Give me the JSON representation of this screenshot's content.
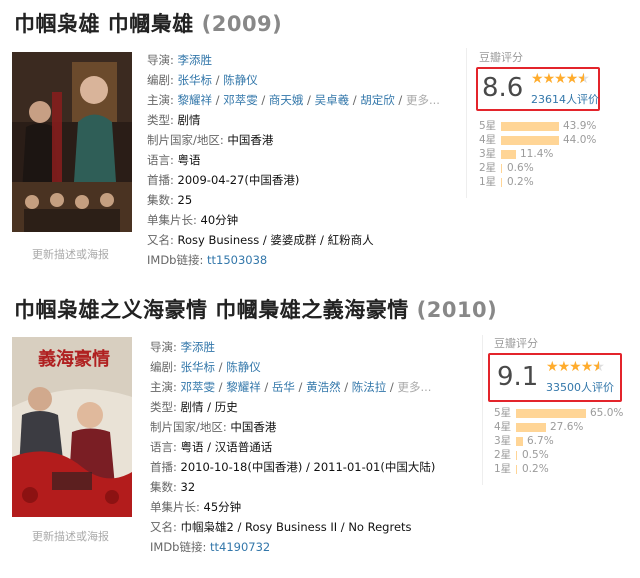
{
  "movies": [
    {
      "title": "巾帼枭雄 巾幗梟雄",
      "year": "(2009)",
      "poster_link": "更新描述或海报",
      "rows": {
        "director_label": "导演:",
        "director": "李添胜",
        "writer_label": "编剧:",
        "writers": [
          "张华标",
          "陈静仪"
        ],
        "cast_label": "主演:",
        "cast": [
          "黎耀祥",
          "邓萃雯",
          "商天娥",
          "吴卓羲",
          "胡定欣"
        ],
        "more": "更多...",
        "genre_label": "类型:",
        "genre": "剧情",
        "country_label": "制片国家/地区:",
        "country": "中国香港",
        "language_label": "语言:",
        "language": "粤语",
        "premiere_label": "首播:",
        "premiere": "2009-04-27(中国香港)",
        "episodes_label": "集数:",
        "episodes": "25",
        "runtime_label": "单集片长:",
        "runtime": "40分钟",
        "aka_label": "又名:",
        "aka": "Rosy Business / 婆婆成群 / 紅粉商人",
        "imdb_label": "IMDb链接:",
        "imdb": "tt1503038"
      },
      "rating": {
        "heading": "豆瓣评分",
        "score": "8.6",
        "votes": "23614人评价",
        "stars_value": 4.5,
        "distribution": [
          {
            "label": "5星",
            "pct": "43.9%",
            "value": 43.9
          },
          {
            "label": "4星",
            "pct": "44.0%",
            "value": 44.0
          },
          {
            "label": "3星",
            "pct": "11.4%",
            "value": 11.4
          },
          {
            "label": "2星",
            "pct": "0.6%",
            "value": 0.6
          },
          {
            "label": "1星",
            "pct": "0.2%",
            "value": 0.2
          }
        ]
      }
    },
    {
      "title": "巾帼枭雄之义海豪情 巾幗梟雄之義海豪情",
      "year": "(2010)",
      "poster_link": "更新描述或海报",
      "rows": {
        "director_label": "导演:",
        "director": "李添胜",
        "writer_label": "编剧:",
        "writers": [
          "张华标",
          "陈静仪"
        ],
        "cast_label": "主演:",
        "cast": [
          "邓萃雯",
          "黎耀祥",
          "岳华",
          "黄浩然",
          "陈法拉"
        ],
        "more": "更多...",
        "genre_label": "类型:",
        "genre": "剧情 / 历史",
        "country_label": "制片国家/地区:",
        "country": "中国香港",
        "language_label": "语言:",
        "language": "粤语 / 汉语普通话",
        "premiere_label": "首播:",
        "premiere": "2010-10-18(中国香港) / 2011-01-01(中国大陆)",
        "episodes_label": "集数:",
        "episodes": "32",
        "runtime_label": "单集片长:",
        "runtime": "45分钟",
        "aka_label": "又名:",
        "aka": "巾帼枭雄2 / Rosy Business II / No Regrets",
        "imdb_label": "IMDb链接:",
        "imdb": "tt4190732"
      },
      "rating": {
        "heading": "豆瓣评分",
        "score": "9.1",
        "votes": "33500人评价",
        "stars_value": 4.5,
        "distribution": [
          {
            "label": "5星",
            "pct": "65.0%",
            "value": 65.0
          },
          {
            "label": "4星",
            "pct": "27.6%",
            "value": 27.6
          },
          {
            "label": "3星",
            "pct": "6.7%",
            "value": 6.7
          },
          {
            "label": "2星",
            "pct": "0.5%",
            "value": 0.5
          },
          {
            "label": "1星",
            "pct": "0.2%",
            "value": 0.2
          }
        ]
      }
    }
  ],
  "colors": {
    "accent_link": "#3377aa",
    "star": "#ffac2d",
    "bar": "#ffd596",
    "highlight_box": "#e3242b"
  }
}
